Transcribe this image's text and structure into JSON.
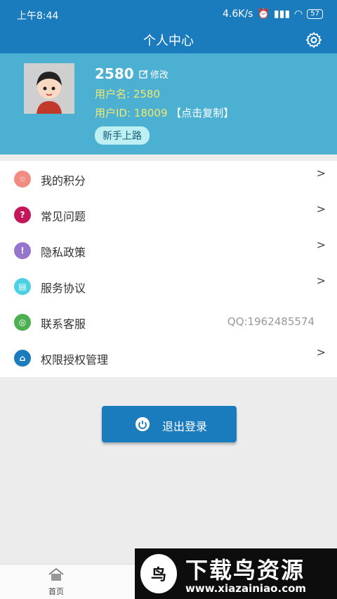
{
  "status_bar": {
    "time": "上午8:44",
    "net_speed": "4.6K/s",
    "battery": "57"
  },
  "header": {
    "title": "个人中心"
  },
  "profile": {
    "display_name": "2580",
    "edit_label": "修改",
    "username": "用户名: 2580",
    "user_id": "用户ID: 18009",
    "copy_label": "【点击复制】",
    "newbie_button": "新手上路"
  },
  "menu": {
    "items": [
      {
        "label": "我的积分",
        "icon": "star-icon",
        "color": "#f28b82"
      },
      {
        "label": "常见问题",
        "icon": "question-icon",
        "color": "#c2185b"
      },
      {
        "label": "隐私政策",
        "icon": "info-icon",
        "color": "#9575cd"
      },
      {
        "label": "服务协议",
        "icon": "document-icon",
        "color": "#4dd0e1"
      },
      {
        "label": "联系客服",
        "icon": "support-icon",
        "color": "#4caf50",
        "value": "QQ:1962485574"
      },
      {
        "label": "权限授权管理",
        "icon": "lock-icon",
        "color": "#1a7bbd"
      }
    ]
  },
  "logout": {
    "label": "退出登录"
  },
  "tabbar": {
    "home_label": "首页"
  },
  "watermark": {
    "title": "下载鸟资源",
    "url": "www.xiazainiao.com"
  },
  "colors": {
    "primary": "#1a7bbd",
    "profile_bg": "#4bb0d1",
    "highlight": "#f5e86e"
  }
}
